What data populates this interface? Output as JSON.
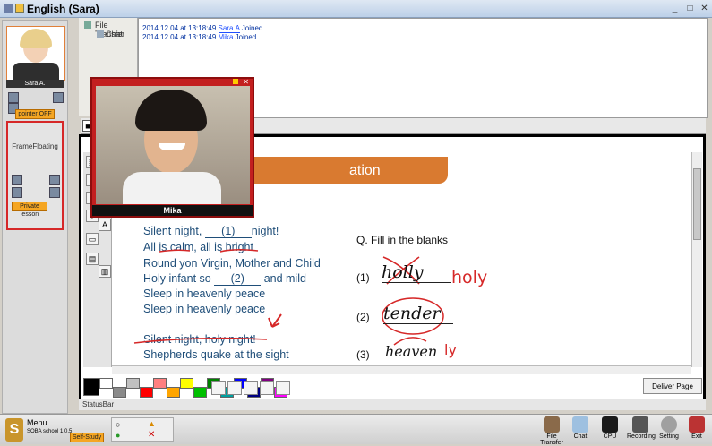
{
  "window": {
    "title": "English (Sara)"
  },
  "left": {
    "user_name": "Sara A.",
    "pointer_label": "pointer OFF",
    "frame_label": "FrameFloating",
    "private_label": "Private lesson"
  },
  "side": {
    "file_transfer": "File Transfer",
    "chat": "Chat"
  },
  "log": [
    {
      "time": "2014.12.04 at 13:18:49",
      "user": "Sara.A",
      "action": "Joined"
    },
    {
      "time": "2014.12.04 at 13:18:49",
      "user": "Mika",
      "action": "Joined"
    }
  ],
  "video": {
    "name": "Mika"
  },
  "page": {
    "banner": "ation",
    "lyrics": [
      {
        "pre": "Silent night, ",
        "blank": "(1)",
        "post": "night!"
      },
      {
        "pre": "All is calm, all is bright",
        "blank": "",
        "post": ""
      },
      {
        "pre": "Round yon Virgin, Mother and Child",
        "blank": "",
        "post": ""
      },
      {
        "pre": "Holy infant so ",
        "blank": "(2)",
        "post": " and mild"
      },
      {
        "pre": "Sleep in heavenly peace",
        "blank": "",
        "post": ""
      },
      {
        "pre": "Sleep in heavenly peace",
        "blank": "",
        "post": ""
      },
      {
        "pre": "Silent night, holy night!",
        "blank": "",
        "post": ""
      },
      {
        "pre": "Shepherds quake at the sight",
        "blank": "",
        "post": ""
      }
    ],
    "question": "Q.   Fill in the blanks",
    "answers": [
      {
        "num": "(1)",
        "written": "holly",
        "correction": "holy"
      },
      {
        "num": "(2)",
        "written": "tender",
        "correction": ""
      },
      {
        "num": "(3)",
        "written": "heaven",
        "correction": "ly"
      }
    ]
  },
  "toolbar": {
    "deliver": "Deliver Page",
    "status": "StatusBar"
  },
  "palette": [
    "#000000",
    "#ffffff",
    "#8a8a8a",
    "#c0c0c0",
    "#ff0000",
    "#ff8080",
    "#ffa500",
    "#ffff00",
    "#00c000",
    "#008000",
    "#00a0a0",
    "#0000ff",
    "#000080",
    "#800080",
    "#ff00ff"
  ],
  "bottom": {
    "menu": "Menu",
    "version": "SOBA school 1.0.5",
    "self_study": "Self-Study",
    "buttons": [
      "File Transfer",
      "Chat",
      "CPU",
      "Recording",
      "Setting",
      "Exit"
    ]
  }
}
